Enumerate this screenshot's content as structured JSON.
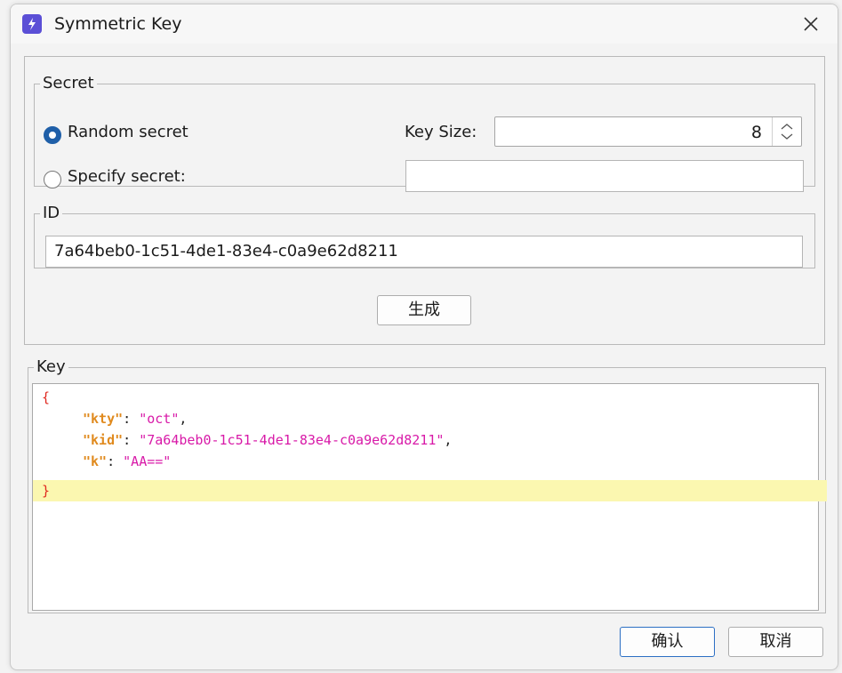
{
  "window": {
    "title": "Symmetric Key",
    "accent": "#5b4fd6"
  },
  "secret": {
    "legend": "Secret",
    "random_label": "Random secret",
    "specify_label": "Specify secret:",
    "key_size_label": "Key Size:",
    "key_size_value": "8",
    "specify_value": "",
    "selected": "random"
  },
  "id": {
    "legend": "ID",
    "value": "7a64beb0-1c51-4de1-83e4-c0a9e62d8211"
  },
  "generate_label": "生成",
  "key": {
    "legend": "Key",
    "open_brace": "{",
    "close_brace": "}",
    "lines": [
      {
        "key": "\"kty\"",
        "sep": ": ",
        "value": "\"oct\"",
        "trail": ","
      },
      {
        "key": "\"kid\"",
        "sep": ": ",
        "value": "\"7a64beb0-1c51-4de1-83e4-c0a9e62d8211\"",
        "trail": ","
      },
      {
        "key": "\"k\"",
        "sep": ": ",
        "value": "\"AA==\"",
        "trail": ""
      }
    ]
  },
  "footer": {
    "ok_label": "确认",
    "cancel_label": "取消"
  }
}
